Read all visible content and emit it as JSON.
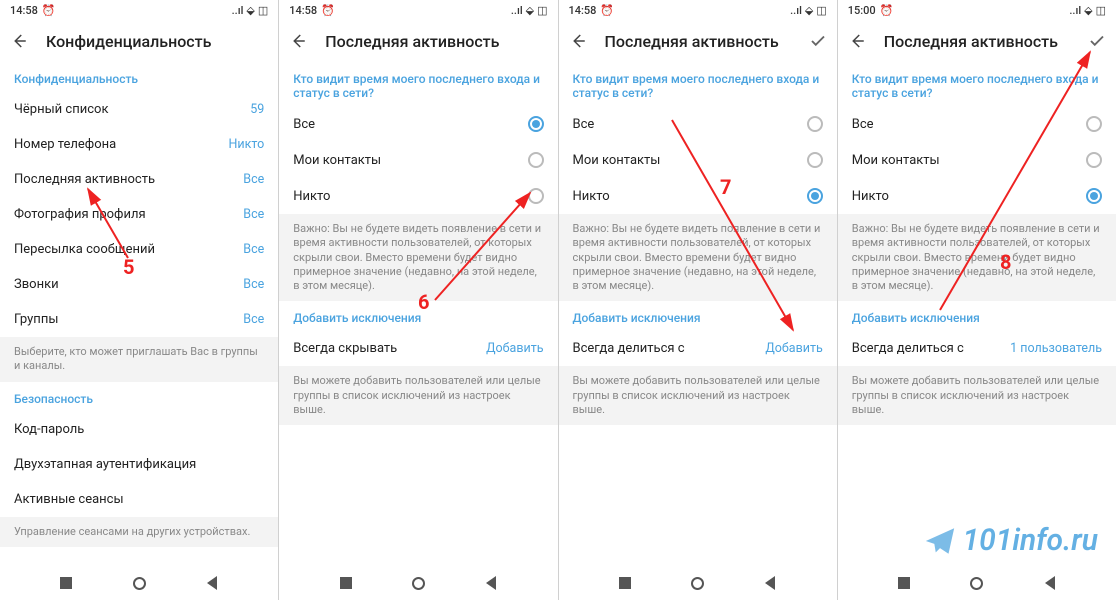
{
  "status": {
    "time1": "14:58",
    "time4": "15:00",
    "alarm": "⏰",
    "signal": "▮▮▮▮",
    "wifi": "📶",
    "batt": "◧"
  },
  "screen1": {
    "title": "Конфиденциальность",
    "section1": "Конфиденциальность",
    "rows": [
      {
        "label": "Чёрный список",
        "value": "59"
      },
      {
        "label": "Номер телефона",
        "value": "Никто"
      },
      {
        "label": "Последняя активность",
        "value": "Все"
      },
      {
        "label": "Фотография профиля",
        "value": "Все"
      },
      {
        "label": "Пересылка сообщений",
        "value": "Все"
      },
      {
        "label": "Звонки",
        "value": "Все"
      },
      {
        "label": "Группы",
        "value": "Все"
      }
    ],
    "hint1": "Выберите, кто может приглашать Вас в группы и каналы.",
    "section2": "Безопасность",
    "sec2rows": [
      {
        "label": "Код-пароль"
      },
      {
        "label": "Двухэтапная аутентификация"
      },
      {
        "label": "Активные сеансы"
      }
    ],
    "hint2": "Управление сеансами на других устройствах."
  },
  "screen2": {
    "title": "Последняя активность",
    "q": "Кто видит время моего последнего входа и статус в сети?",
    "opts": [
      "Все",
      "Мои контакты",
      "Никто"
    ],
    "selected": 0,
    "hint": "Важно: Вы не будете видеть появление в сети и время активности пользователей, от которых скрыли свои. Вместо времени будет видно примерное значение (недавно, на этой неделе, в этом месяце).",
    "exc_header": "Добавить исключения",
    "exc_row_label": "Всегда скрывать",
    "exc_row_value": "Добавить",
    "exc_hint": "Вы можете добавить пользователей или целые группы в список исключений из настроек выше."
  },
  "screen3": {
    "title": "Последняя активность",
    "q": "Кто видит время моего последнего входа и статус в сети?",
    "opts": [
      "Все",
      "Мои контакты",
      "Никто"
    ],
    "selected": 2,
    "hint": "Важно: Вы не будете видеть появление в сети и время активности пользователей, от которых скрыли свои. Вместо времени будет видно примерное значение (недавно, на этой неделе, в этом месяце).",
    "exc_header": "Добавить исключения",
    "exc_row_label": "Всегда делиться с",
    "exc_row_value": "Добавить",
    "exc_hint": "Вы можете добавить пользователей или целые группы в список исключений из настроек выше."
  },
  "screen4": {
    "title": "Последняя активность",
    "q": "Кто видит время моего последнего входа и статус в сети?",
    "opts": [
      "Все",
      "Мои контакты",
      "Никто"
    ],
    "selected": 2,
    "hint": "Важно: Вы не будете видеть появление в сети и время активности пользователей, от которых скрыли свои. Вместо времени будет видно примерное значение (недавно, на этой неделе, в этом месяце).",
    "exc_header": "Добавить исключения",
    "exc_row_label": "Всегда делиться с",
    "exc_row_value": "1 пользователь",
    "exc_hint": "Вы можете добавить пользователей или целые группы в список исключений из настроек выше."
  },
  "overlay": {
    "n5": "5",
    "n6": "6",
    "n7": "7",
    "n8": "8"
  },
  "watermark": "101info.ru"
}
